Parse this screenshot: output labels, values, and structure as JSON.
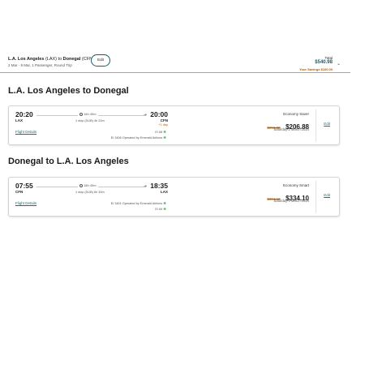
{
  "header": {
    "origin_city": "L.A. Los Angeles",
    "origin_code": "(LAX)",
    "connector": "to",
    "dest_city": "Donegal",
    "dest_code": "(CFN)",
    "subtitle": "2 Mar - 9 Mar, 1 Passenger, Round Trip",
    "edit_label": "Edit",
    "total_label": "Total",
    "total_amount": "$540.98",
    "savings": "Your Savings $100.00"
  },
  "sections": [
    {
      "title": "L.A. Los Angeles to Donegal",
      "flight": {
        "dep_time": "20:20",
        "dep_code": "LAX",
        "arr_time": "20:00",
        "arr_code": "CFN",
        "plus_day": "+1 day",
        "duration": "16h 40m",
        "stops": "1 stop (DUB) 4h 20m",
        "details_link": "Flight Details",
        "op_line_1": "EI 68",
        "op_line_2": "EI 3406 Operated by Emerald Airlines",
        "fare_type": "Economy Saver",
        "old_price": "$256.88",
        "new_price": "$206.88",
        "date": "Saturday 2 March 2024",
        "edit_label": "Edit"
      }
    },
    {
      "title": "Donegal to L.A. Los Angeles",
      "flight": {
        "dep_time": "07:55",
        "dep_code": "CFN",
        "arr_time": "18:35",
        "arr_code": "LAX",
        "plus_day": "",
        "duration": "18h 40m",
        "stops": "1 stop (DUB) 6h 30m",
        "details_link": "Flight Details",
        "op_line_1": "EI 3401 Operated by Emerald Airlines",
        "op_line_2": "EI 69",
        "fare_type": "Economy Smart",
        "old_price": "$384.10",
        "new_price": "$334.10",
        "date": "Saturday 9 March 2024",
        "edit_label": "Edit"
      }
    }
  ],
  "colors": {
    "accent": "#1f5c6b",
    "header_rule": "#8cc63f",
    "savings": "#b35d00",
    "eco_leaf": "#3aa34a"
  }
}
